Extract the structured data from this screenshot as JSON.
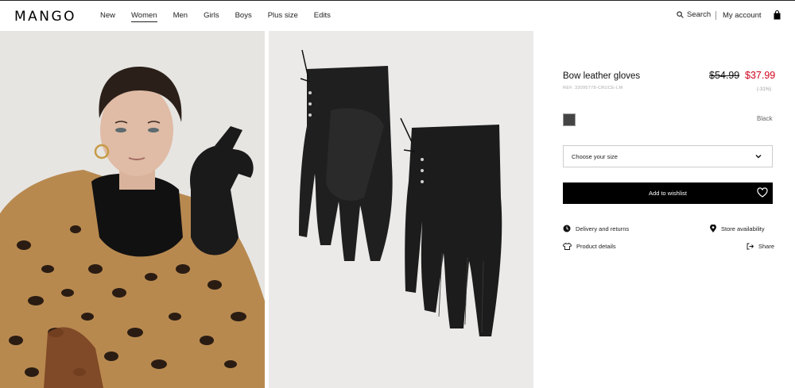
{
  "header": {
    "logo": "MANGO",
    "nav": [
      "New",
      "Women",
      "Men",
      "Girls",
      "Boys",
      "Plus size",
      "Edits"
    ],
    "active_nav": "Women",
    "search_label": "Search",
    "account_label": "My account"
  },
  "product": {
    "name": "Bow leather gloves",
    "ref": "REF. 33095778-CRUCE-LM",
    "old_price": "$54.99",
    "new_price": "$37.99",
    "discount": "(-31%)",
    "color": "Black",
    "size_placeholder": "Choose your size",
    "wishlist_label": "Add to wishlist"
  },
  "links": {
    "delivery": "Delivery and returns",
    "store": "Store availability",
    "details": "Product details",
    "share": "Share"
  },
  "icons": {
    "search": "search-icon",
    "bag": "bag-icon",
    "chevron": "chevron-down-icon",
    "heart": "heart-icon",
    "clock": "clock-icon",
    "pin": "location-pin-icon",
    "shirt": "shirt-icon",
    "share": "share-icon"
  },
  "colors": {
    "sale_price": "#d0021b",
    "button_bg": "#000000",
    "accent_text": "#111111"
  }
}
